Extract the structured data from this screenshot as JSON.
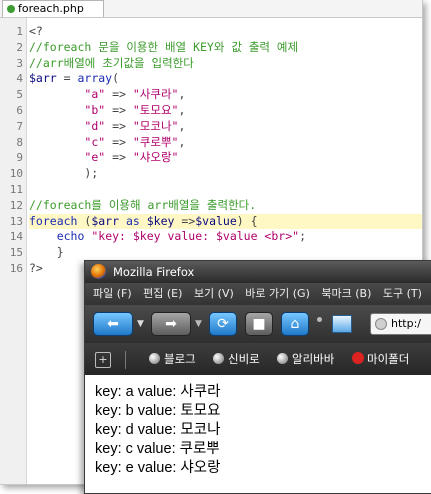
{
  "editor": {
    "tab_label": "foreach.php",
    "line_numbers": [
      "1",
      "2",
      "3",
      "4",
      "5",
      "6",
      "7",
      "8",
      "9",
      "10",
      "11",
      "12",
      "13",
      "14",
      "15",
      "16"
    ],
    "lines": [
      {
        "parts": [
          {
            "t": "<?",
            "c": "op"
          }
        ]
      },
      {
        "parts": [
          {
            "t": "//foreach 문을 이용한 배열 KEY와 값 출력 예제",
            "c": "cmt"
          }
        ]
      },
      {
        "parts": [
          {
            "t": "//arr배열에 초기값을 입력한다",
            "c": "cmt"
          }
        ]
      },
      {
        "parts": [
          {
            "t": "$arr",
            "c": "var"
          },
          {
            "t": " = ",
            "c": "op"
          },
          {
            "t": "array",
            "c": "kw"
          },
          {
            "t": "(",
            "c": "op"
          }
        ]
      },
      {
        "parts": [
          {
            "t": "        ",
            "c": "op"
          },
          {
            "t": "\"a\"",
            "c": "str"
          },
          {
            "t": " => ",
            "c": "op"
          },
          {
            "t": "\"사쿠라\"",
            "c": "str"
          },
          {
            "t": ",",
            "c": "op"
          }
        ]
      },
      {
        "parts": [
          {
            "t": "        ",
            "c": "op"
          },
          {
            "t": "\"b\"",
            "c": "str"
          },
          {
            "t": " => ",
            "c": "op"
          },
          {
            "t": "\"토모요\"",
            "c": "str"
          },
          {
            "t": ",",
            "c": "op"
          }
        ]
      },
      {
        "parts": [
          {
            "t": "        ",
            "c": "op"
          },
          {
            "t": "\"d\"",
            "c": "str"
          },
          {
            "t": " => ",
            "c": "op"
          },
          {
            "t": "\"모코나\"",
            "c": "str"
          },
          {
            "t": ",",
            "c": "op"
          }
        ]
      },
      {
        "parts": [
          {
            "t": "        ",
            "c": "op"
          },
          {
            "t": "\"c\"",
            "c": "str"
          },
          {
            "t": " => ",
            "c": "op"
          },
          {
            "t": "\"쿠로뿌\"",
            "c": "str"
          },
          {
            "t": ",",
            "c": "op"
          }
        ]
      },
      {
        "parts": [
          {
            "t": "        ",
            "c": "op"
          },
          {
            "t": "\"e\"",
            "c": "str"
          },
          {
            "t": " => ",
            "c": "op"
          },
          {
            "t": "\"샤오랑\"",
            "c": "str"
          }
        ]
      },
      {
        "parts": [
          {
            "t": "        );",
            "c": "op"
          }
        ]
      },
      {
        "parts": []
      },
      {
        "parts": [
          {
            "t": "//foreach를 이용해 arr배열을 출력한다.",
            "c": "cmt"
          }
        ]
      },
      {
        "hl": true,
        "parts": [
          {
            "t": "foreach",
            "c": "kw"
          },
          {
            "t": " (",
            "c": "op"
          },
          {
            "t": "$arr",
            "c": "var"
          },
          {
            "t": " as ",
            "c": "kw"
          },
          {
            "t": "$key",
            "c": "var"
          },
          {
            "t": " =>",
            "c": "op"
          },
          {
            "t": "$value",
            "c": "var"
          },
          {
            "t": ") {",
            "c": "op"
          }
        ]
      },
      {
        "parts": [
          {
            "t": "    ",
            "c": "op"
          },
          {
            "t": "echo",
            "c": "kw"
          },
          {
            "t": " ",
            "c": "op"
          },
          {
            "t": "\"key: $key value: $value <br>\"",
            "c": "str"
          },
          {
            "t": ";",
            "c": "op"
          }
        ]
      },
      {
        "parts": [
          {
            "t": "    }",
            "c": "op"
          }
        ]
      },
      {
        "parts": [
          {
            "t": "?>",
            "c": "op"
          }
        ]
      }
    ]
  },
  "browser": {
    "title": "Mozilla Firefox",
    "menu": [
      "파일 (F)",
      "편집 (E)",
      "보기 (V)",
      "바로 가기 (G)",
      "북마크 (B)",
      "도구 (T)"
    ],
    "url_text": "http:/",
    "bookmarks": [
      "블로그",
      "신비로",
      "알리바바",
      "마이폴더"
    ],
    "output_lines": [
      "key: a value: 사쿠라",
      "key: b value: 토모요",
      "key: d value: 모코나",
      "key: c value: 쿠로뿌",
      "key: e value: 샤오랑"
    ]
  },
  "colors": {
    "comment": "#3b9b2b",
    "keyword": "#1b2bb2",
    "string": "#b0006a",
    "highlight_line": "#fff8c4"
  }
}
